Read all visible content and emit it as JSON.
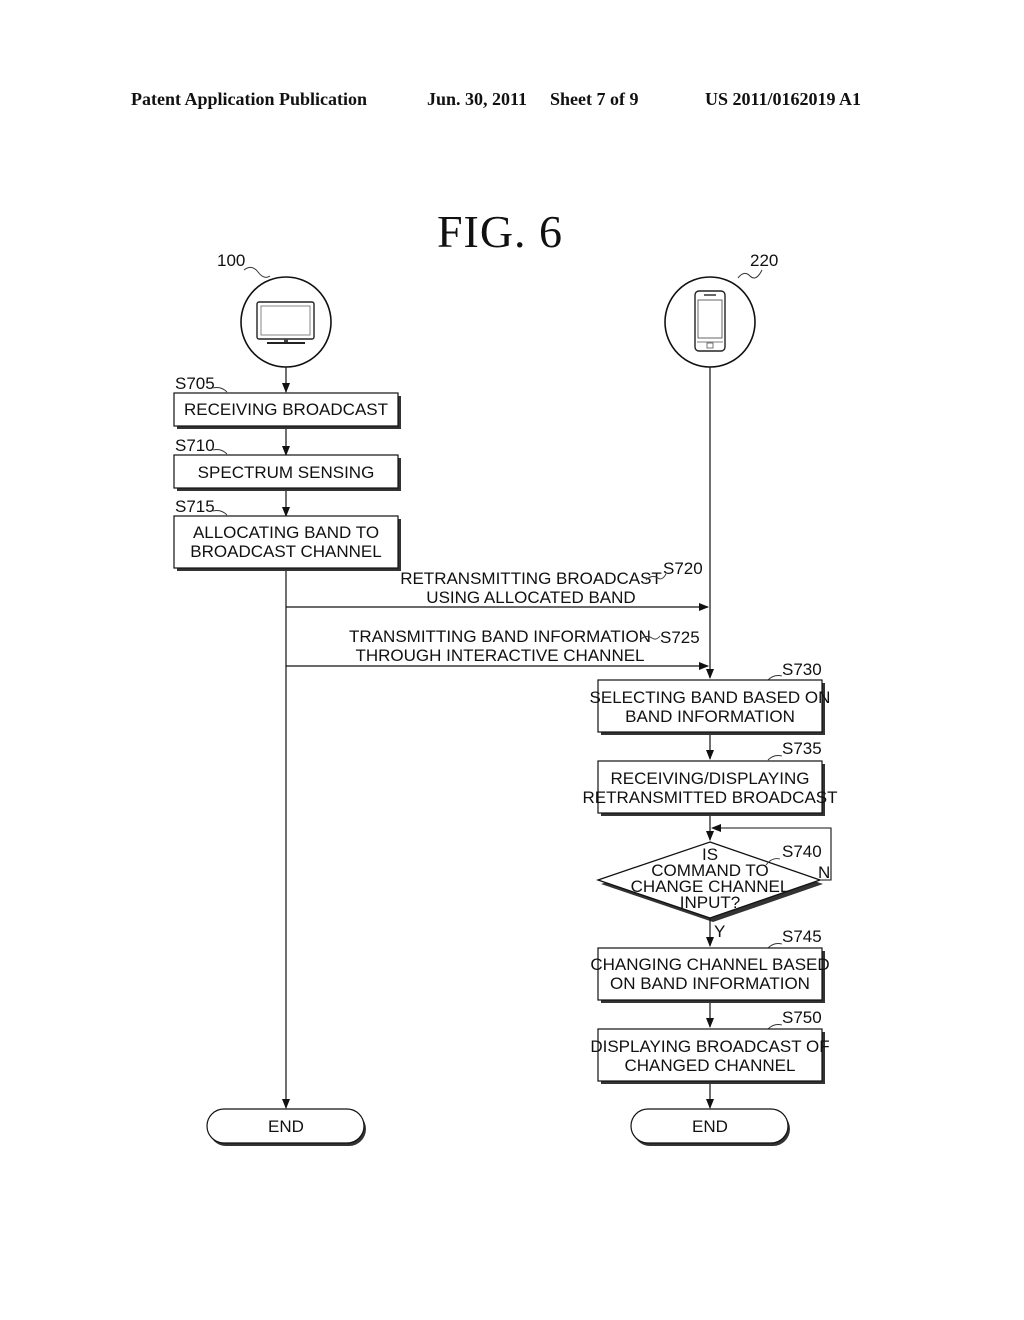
{
  "header": {
    "publication": "Patent Application Publication",
    "date": "Jun. 30, 2011",
    "sheet": "Sheet 7 of 9",
    "number": "US 2011/0162019 A1"
  },
  "figure": {
    "title": "FIG.  6"
  },
  "actors": [
    {
      "ref": "100",
      "icon": "tv-icon"
    },
    {
      "ref": "220",
      "icon": "mobile-phone-icon"
    }
  ],
  "steps": {
    "s705": {
      "id": "S705",
      "lines": [
        "RECEIVING BROADCAST"
      ]
    },
    "s710": {
      "id": "S710",
      "lines": [
        "SPECTRUM SENSING"
      ]
    },
    "s715": {
      "id": "S715",
      "lines": [
        "ALLOCATING BAND TO",
        "BROADCAST CHANNEL"
      ]
    },
    "s720": {
      "id": "S720",
      "lines": [
        "RETRANSMITTING BROADCAST",
        "USING ALLOCATED BAND"
      ]
    },
    "s725": {
      "id": "S725",
      "lines": [
        "TRANSMITTING BAND INFORMATION",
        "THROUGH INTERACTIVE CHANNEL"
      ]
    },
    "s730": {
      "id": "S730",
      "lines": [
        "SELECTING BAND BASED ON",
        "BAND INFORMATION"
      ]
    },
    "s735": {
      "id": "S735",
      "lines": [
        "RECEIVING/DISPLAYING",
        "RETRANSMITTED BROADCAST"
      ]
    },
    "s740": {
      "id": "S740",
      "lines": [
        "IS",
        "COMMAND TO",
        "CHANGE CHANNEL",
        "INPUT?"
      ],
      "yes": "Y",
      "no": "N"
    },
    "s745": {
      "id": "S745",
      "lines": [
        "CHANGING CHANNEL BASED",
        "ON BAND INFORMATION"
      ]
    },
    "s750": {
      "id": "S750",
      "lines": [
        "DISPLAYING BROADCAST OF",
        "CHANGED CHANNEL"
      ]
    }
  },
  "terminals": {
    "left_end": "END",
    "right_end": "END"
  }
}
